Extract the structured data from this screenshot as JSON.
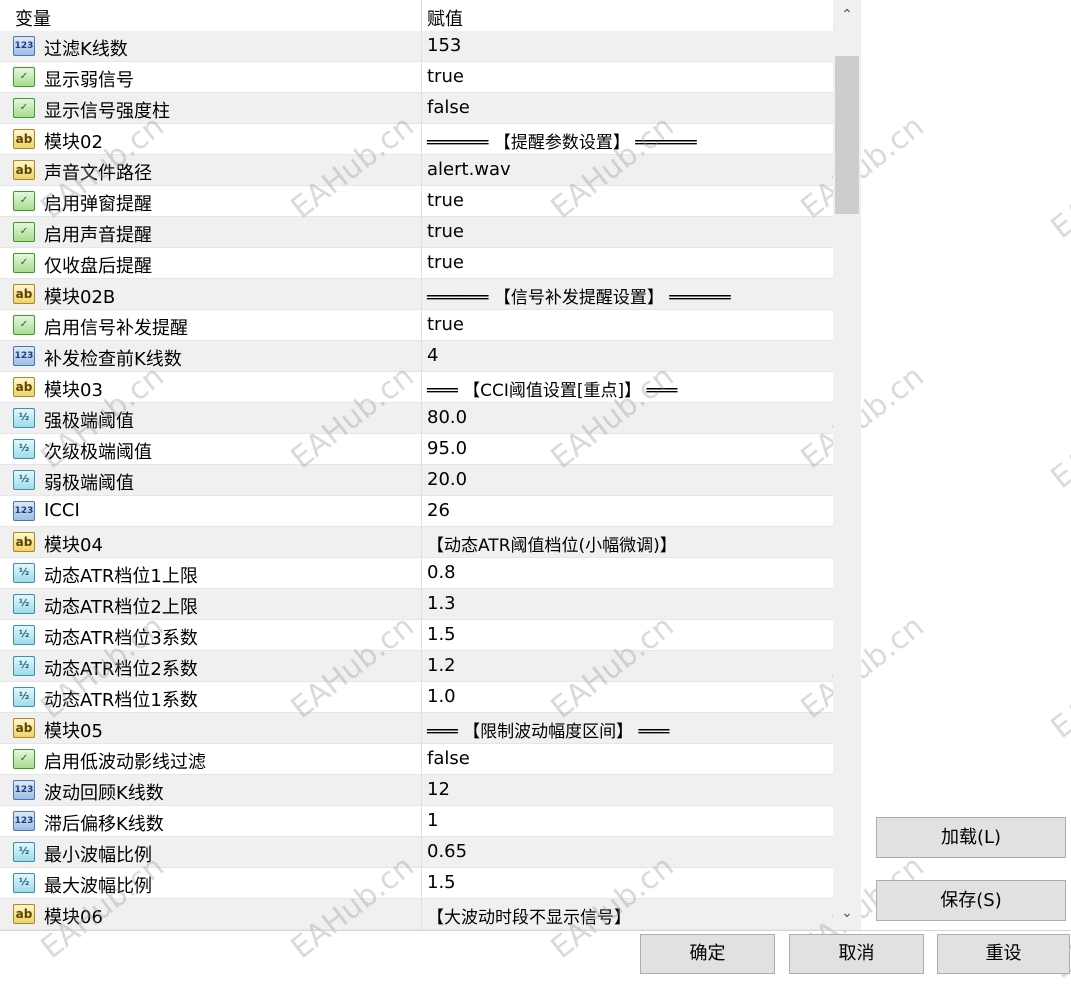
{
  "headers": {
    "variable": "变量",
    "value": "赋值"
  },
  "rows": [
    {
      "icon": "int",
      "name": "过滤K线数",
      "value": "153"
    },
    {
      "icon": "bool",
      "name": "显示弱信号",
      "value": "true"
    },
    {
      "icon": "bool",
      "name": "显示信号强度柱",
      "value": "false"
    },
    {
      "icon": "str",
      "name": "模块02",
      "value": "══════ 【提醒参数设置】 ══════"
    },
    {
      "icon": "str",
      "name": "声音文件路径",
      "value": "alert.wav"
    },
    {
      "icon": "bool",
      "name": "启用弹窗提醒",
      "value": "true"
    },
    {
      "icon": "bool",
      "name": "启用声音提醒",
      "value": "true"
    },
    {
      "icon": "bool",
      "name": "仅收盘后提醒",
      "value": "true"
    },
    {
      "icon": "str",
      "name": "模块02B",
      "value": "══════ 【信号补发提醒设置】 ══════"
    },
    {
      "icon": "bool",
      "name": "启用信号补发提醒",
      "value": "true"
    },
    {
      "icon": "int",
      "name": "补发检查前K线数",
      "value": "4"
    },
    {
      "icon": "str",
      "name": "模块03",
      "value": "═══ 【CCI阈值设置[重点]】 ═══"
    },
    {
      "icon": "dbl",
      "name": "强极端阈值",
      "value": "80.0"
    },
    {
      "icon": "dbl",
      "name": "次级极端阈值",
      "value": "95.0"
    },
    {
      "icon": "dbl",
      "name": "弱极端阈值",
      "value": "20.0"
    },
    {
      "icon": "int",
      "name": "ICCI",
      "value": "26"
    },
    {
      "icon": "str",
      "name": "模块04",
      "value": " 【动态ATR阈值档位(小幅微调)】"
    },
    {
      "icon": "dbl",
      "name": "动态ATR档位1上限",
      "value": "0.8"
    },
    {
      "icon": "dbl",
      "name": "动态ATR档位2上限",
      "value": "1.3"
    },
    {
      "icon": "dbl",
      "name": "动态ATR档位3系数",
      "value": "1.5"
    },
    {
      "icon": "dbl",
      "name": "动态ATR档位2系数",
      "value": "1.2"
    },
    {
      "icon": "dbl",
      "name": "动态ATR档位1系数",
      "value": "1.0"
    },
    {
      "icon": "str",
      "name": "模块05",
      "value": "═══ 【限制波动幅度区间】 ═══"
    },
    {
      "icon": "bool",
      "name": "启用低波动影线过滤",
      "value": "false"
    },
    {
      "icon": "int",
      "name": "波动回顾K线数",
      "value": "12"
    },
    {
      "icon": "int",
      "name": "滞后偏移K线数",
      "value": "1"
    },
    {
      "icon": "dbl",
      "name": "最小波幅比例",
      "value": "0.65"
    },
    {
      "icon": "dbl",
      "name": "最大波幅比例",
      "value": "1.5"
    },
    {
      "icon": "str",
      "name": "模块06",
      "value": " 【大波动时段不显示信号】"
    }
  ],
  "icon_glyphs": {
    "int": "123",
    "bool": "✓",
    "str": "ab",
    "dbl": "½"
  },
  "watermark": "EAHub.cn",
  "buttons": {
    "load": "加载(L)",
    "save": "保存(S)",
    "ok": "确定",
    "cancel": "取消",
    "reset": "重设"
  },
  "scroll": {
    "up": "⌃",
    "down": "⌄"
  }
}
